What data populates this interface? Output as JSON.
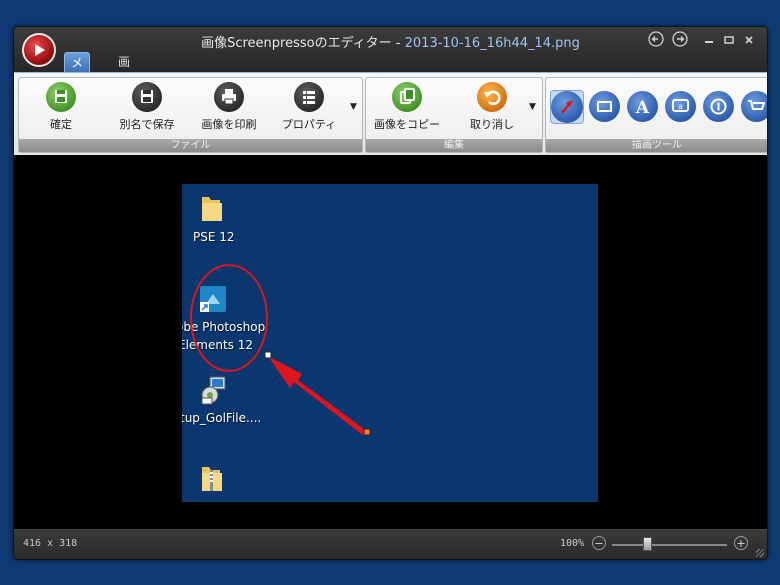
{
  "window": {
    "title_prefix": "画像Screenpressoのエディター -",
    "title_file": "2013-10-16_16h44_14.png"
  },
  "tabs": [
    {
      "label": "メイン",
      "active": true
    },
    {
      "label": "画像",
      "active": false
    }
  ],
  "ribbon": {
    "file_group": {
      "label": "ファイル",
      "buttons": [
        {
          "label": "確定",
          "icon": "save-icon"
        },
        {
          "label": "別名で保存",
          "icon": "save-as-icon"
        },
        {
          "label": "画像を印刷",
          "icon": "print-icon"
        },
        {
          "label": "プロパティ",
          "icon": "properties-icon"
        }
      ]
    },
    "edit_group": {
      "label": "編集",
      "buttons": [
        {
          "label": "画像をコピー",
          "icon": "copy-icon"
        },
        {
          "label": "取り消し",
          "icon": "undo-icon"
        }
      ]
    },
    "draw_group": {
      "label": "描画ツール",
      "tools": [
        "arrow-tool-icon",
        "rectangle-tool-icon",
        "text-tool-icon",
        "callout-tool-icon",
        "step-number-tool-icon",
        "more-tools-icon"
      ]
    }
  },
  "screenshot": {
    "desktop_icons": [
      {
        "label": "PSE 12"
      },
      {
        "label_line1": "obe Photoshop",
        "label_line2": "Elements 12"
      },
      {
        "label": "tup_GolFile...."
      },
      {
        "label": ""
      }
    ]
  },
  "status": {
    "image_size": "416 x 318",
    "zoom": "100%",
    "zoom_level": 1.0
  },
  "colors": {
    "annotation": "#e0141b",
    "desktop_bg": "#0a3770"
  }
}
